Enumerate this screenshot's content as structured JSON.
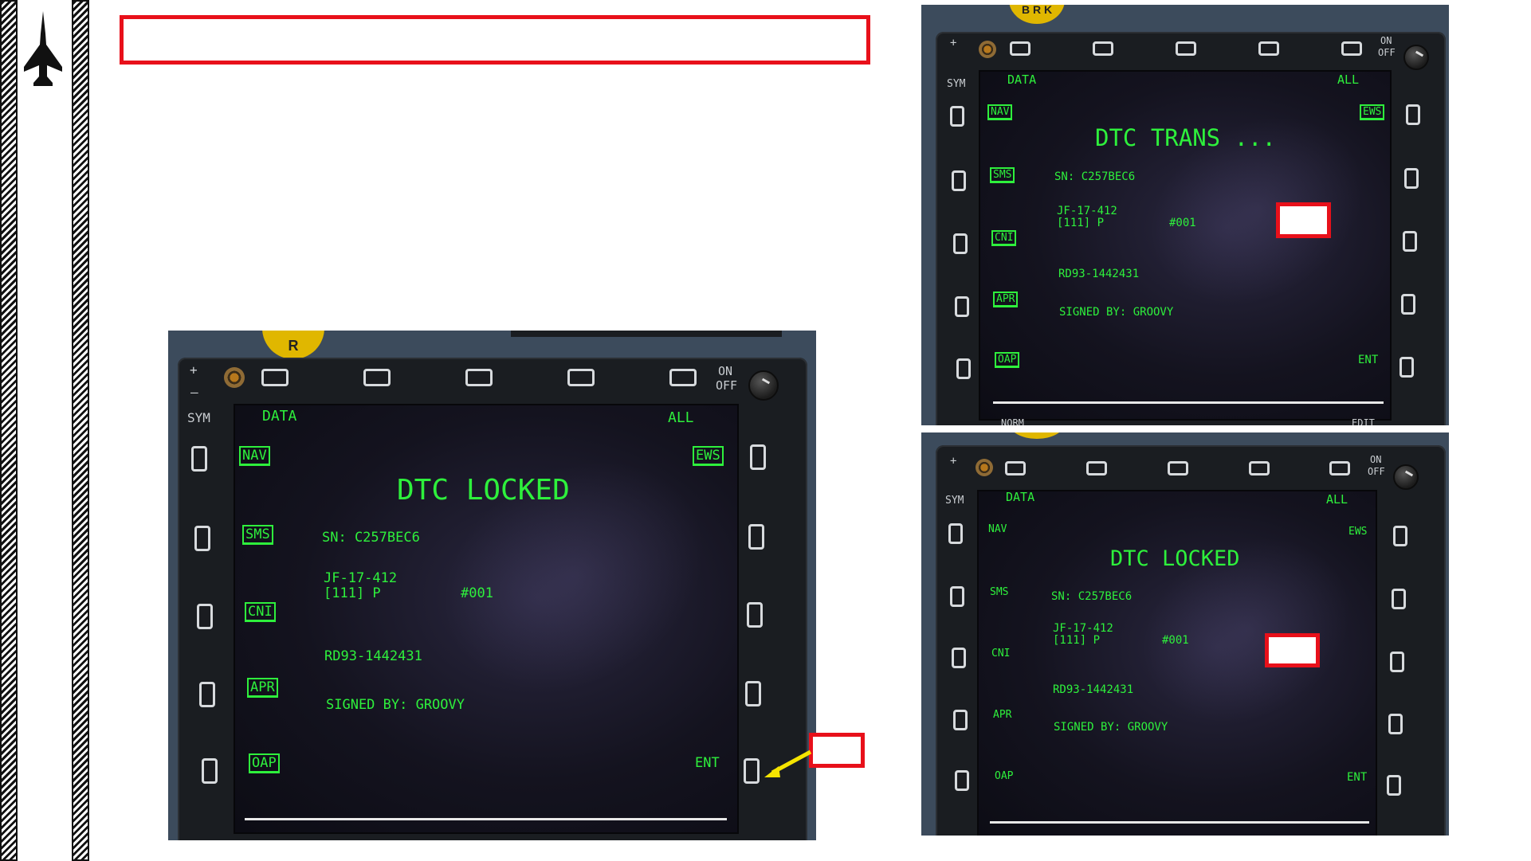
{
  "title_box": {
    "text": ""
  },
  "main_mfd": {
    "top_labels": {
      "on": "ON",
      "off": "OFF",
      "sym": "SYM",
      "plus": "+",
      "minus": "–"
    },
    "brightness_label": "R",
    "header_left": "DATA",
    "header_right": "ALL",
    "left_menu": [
      "NAV",
      "SMS",
      "CNI",
      "APR",
      "OAP"
    ],
    "right_menu": [
      "EWS",
      "ENT"
    ],
    "status": "DTC LOCKED",
    "sn": "SN: C257BEC6",
    "id_line1": "JF-17-412",
    "id_line2": "[111]  P",
    "id_num": "#001",
    "rd": "RD93-1442431",
    "signed": "SIGNED BY: GROOVY",
    "callout_text": ""
  },
  "trans_mfd": {
    "top_labels": {
      "on": "ON",
      "off": "OFF",
      "sym": "SYM"
    },
    "brightness_label": "B R K",
    "header_left": "DATA",
    "header_right": "ALL",
    "left_menu": [
      "NAV",
      "SMS",
      "CNI",
      "APR",
      "OAP"
    ],
    "right_menu": [
      "EWS",
      "ENT"
    ],
    "status": "DTC TRANS ...",
    "sn": "SN: C257BEC6",
    "id_line1": "JF-17-412",
    "id_line2": "[111]  P",
    "id_num": "#001",
    "rd": "RD93-1442431",
    "signed": "SIGNED BY: GROOVY",
    "bottom_left": "NORM",
    "bottom_right": "EDIT"
  },
  "locked_mfd": {
    "top_labels": {
      "on": "ON",
      "off": "OFF",
      "sym": "SYM"
    },
    "header_left": "DATA",
    "header_right": "ALL",
    "left_menu": [
      "NAV",
      "SMS",
      "CNI",
      "APR",
      "OAP"
    ],
    "right_menu": [
      "EWS",
      "ENT"
    ],
    "status": "DTC LOCKED",
    "sn": "SN: C257BEC6",
    "id_line1": "JF-17-412",
    "id_line2": "[111]  P",
    "id_num": "#001",
    "rd": "RD93-1442431",
    "signed": "SIGNED BY: GROOVY"
  },
  "colors": {
    "accent_red": "#e8101a",
    "mfd_green": "#2ef03c",
    "arrow_yellow": "#f5e400"
  },
  "icons": [
    "jet-icon",
    "brightness-knob",
    "power-knob",
    "yellow-arrow"
  ]
}
